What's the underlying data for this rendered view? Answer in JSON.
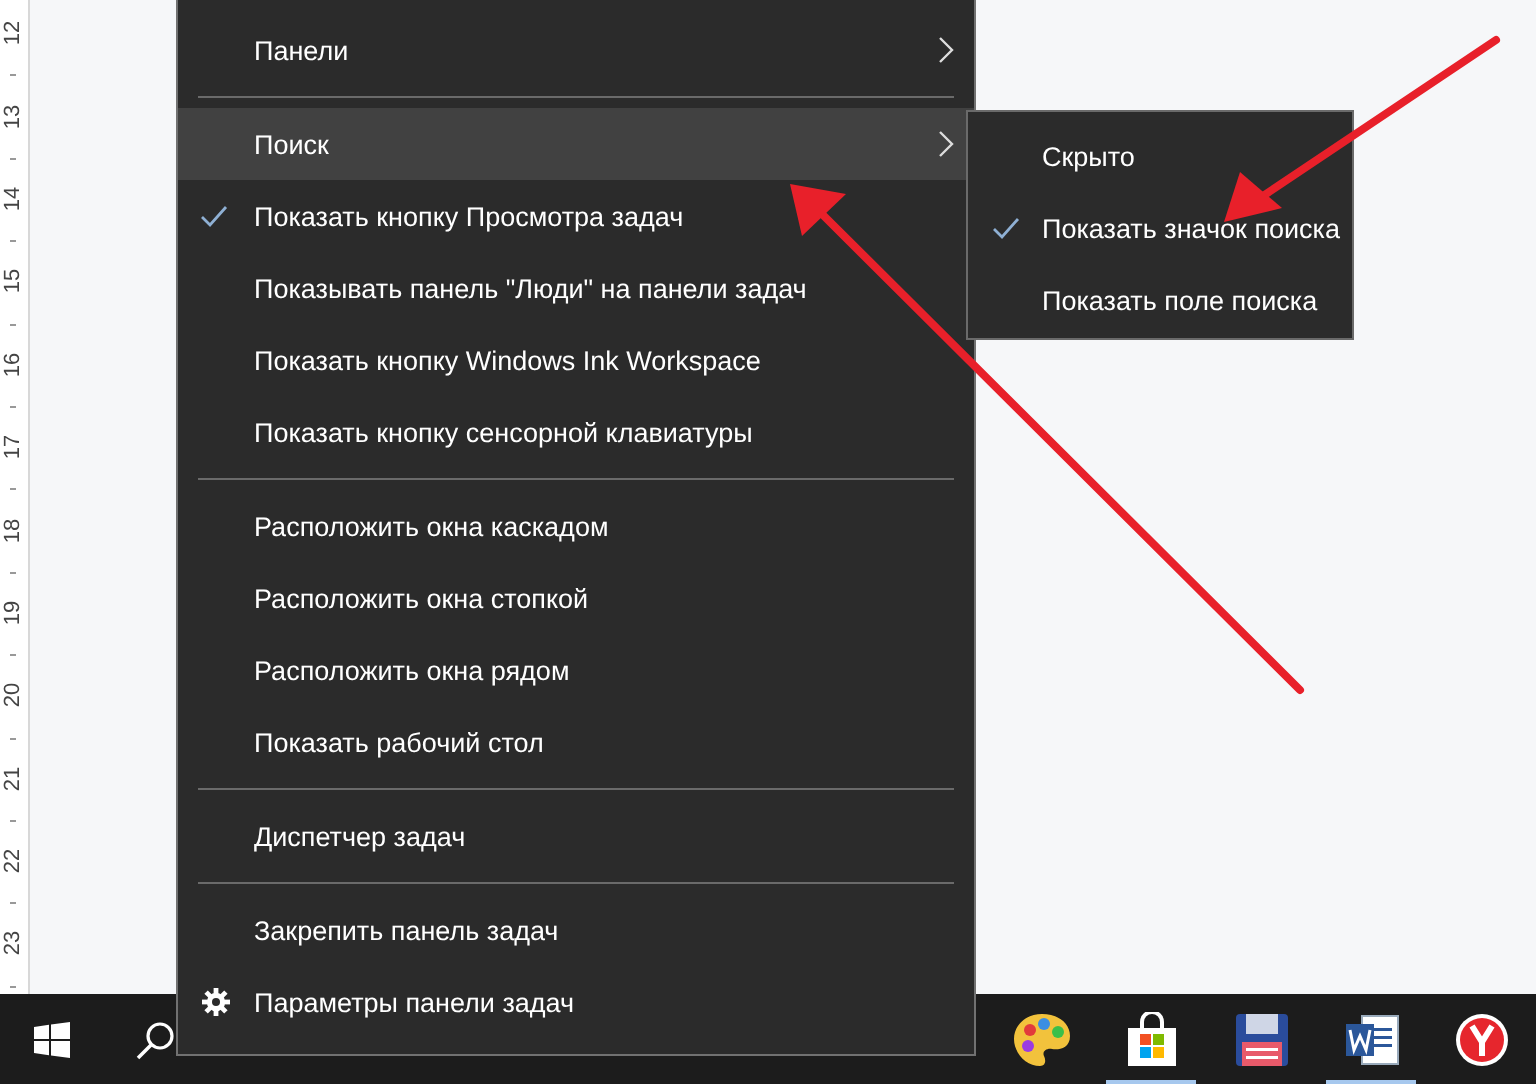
{
  "ruler": {
    "marks": [
      "12",
      "13",
      "14",
      "15",
      "16",
      "17",
      "18",
      "19",
      "20",
      "21",
      "22",
      "23"
    ]
  },
  "context_menu": {
    "items": [
      {
        "kind": "item",
        "label": "Панели",
        "submenu": true,
        "checked": false,
        "selected": false
      },
      {
        "kind": "separator"
      },
      {
        "kind": "item",
        "label": "Поиск",
        "submenu": true,
        "checked": false,
        "selected": true
      },
      {
        "kind": "item",
        "label": "Показать кнопку Просмотра задач",
        "submenu": false,
        "checked": true,
        "selected": false
      },
      {
        "kind": "item",
        "label": "Показывать панель \"Люди\" на панели задач",
        "submenu": false,
        "checked": false,
        "selected": false
      },
      {
        "kind": "item",
        "label": "Показать кнопку Windows Ink Workspace",
        "submenu": false,
        "checked": false,
        "selected": false
      },
      {
        "kind": "item",
        "label": "Показать кнопку сенсорной клавиатуры",
        "submenu": false,
        "checked": false,
        "selected": false
      },
      {
        "kind": "separator"
      },
      {
        "kind": "item",
        "label": "Расположить окна каскадом",
        "submenu": false,
        "checked": false,
        "selected": false
      },
      {
        "kind": "item",
        "label": "Расположить окна стопкой",
        "submenu": false,
        "checked": false,
        "selected": false
      },
      {
        "kind": "item",
        "label": "Расположить окна рядом",
        "submenu": false,
        "checked": false,
        "selected": false
      },
      {
        "kind": "item",
        "label": "Показать рабочий стол",
        "submenu": false,
        "checked": false,
        "selected": false
      },
      {
        "kind": "separator"
      },
      {
        "kind": "item",
        "label": "Диспетчер задач",
        "submenu": false,
        "checked": false,
        "selected": false
      },
      {
        "kind": "separator"
      },
      {
        "kind": "item",
        "label": "Закрепить панель задач",
        "submenu": false,
        "checked": false,
        "selected": false
      },
      {
        "kind": "settings",
        "label": "Параметры панели задач",
        "submenu": false,
        "checked": false,
        "selected": false
      }
    ]
  },
  "submenu": {
    "items": [
      {
        "label": "Скрыто",
        "checked": false
      },
      {
        "label": "Показать значок поиска",
        "checked": true
      },
      {
        "label": "Показать поле поиска",
        "checked": false
      }
    ]
  },
  "taskbar": {
    "apps": [
      {
        "kind": "paint",
        "running": false
      },
      {
        "kind": "store",
        "running": true
      },
      {
        "kind": "floppy",
        "running": false
      },
      {
        "kind": "word",
        "running": true
      },
      {
        "kind": "browser",
        "running": false
      }
    ]
  }
}
